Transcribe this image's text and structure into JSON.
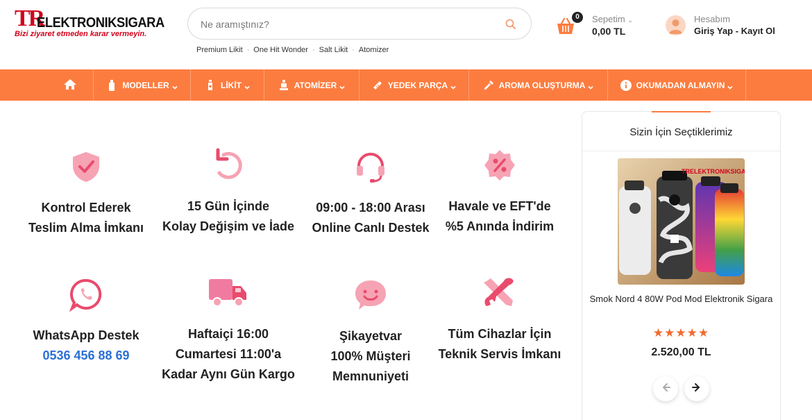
{
  "header": {
    "logo_prefix": "TR",
    "logo_name": "ELEKTRONIKSIGARA",
    "logo_tagline": "Bizi ziyaret etmeden karar vermeyin.",
    "search_placeholder": "Ne aramıştınız?",
    "quick_links": [
      "Premium Likit",
      "One Hit Wonder",
      "Salt Likit",
      "Atomizer"
    ],
    "cart": {
      "label": "Sepetim",
      "count": "0",
      "total": "0,00 TL"
    },
    "account": {
      "label": "Hesabım",
      "login": "Giriş Yap",
      "sep": "-",
      "register": "Kayıt Ol"
    }
  },
  "nav": {
    "items": [
      {
        "label": "",
        "icon": "home-icon"
      },
      {
        "label": "MODELLER",
        "icon": "device-icon"
      },
      {
        "label": "LİKİT",
        "icon": "bottle-icon"
      },
      {
        "label": "ATOMİZER",
        "icon": "atomizer-icon"
      },
      {
        "label": "YEDEK PARÇA",
        "icon": "part-icon"
      },
      {
        "label": "AROMA OLUŞTURMA",
        "icon": "pipette-icon"
      },
      {
        "label": "OKUMADAN ALMAYIN",
        "icon": "info-icon"
      }
    ]
  },
  "features": [
    {
      "icon": "shield-check-icon",
      "lines": [
        "Kontrol Ederek",
        "Teslim Alma İmkanı"
      ]
    },
    {
      "icon": "return-icon",
      "lines": [
        "15 Gün İçinde",
        "Kolay Değişim ve İade"
      ]
    },
    {
      "icon": "headset-icon",
      "lines": [
        "09:00 - 18:00 Arası",
        "Online Canlı Destek"
      ]
    },
    {
      "icon": "discount-icon",
      "lines": [
        "Havale ve EFT'de",
        "%5 Anında İndirim"
      ]
    },
    {
      "icon": "whatsapp-icon",
      "lines": [
        "WhatsApp Destek"
      ],
      "phone": "0536 456 88 69"
    },
    {
      "icon": "truck-icon",
      "lines": [
        "Haftaiçi 16:00",
        "Cumartesi 11:00'a",
        "Kadar Aynı Gün Kargo"
      ]
    },
    {
      "icon": "smile-chat-icon",
      "lines": [
        "Şikayetvar",
        "100% Müşteri",
        "Memnuniyeti"
      ]
    },
    {
      "icon": "tools-icon",
      "lines": [
        "Tüm Cihazlar İçin",
        "Teknik Servis İmkanı"
      ]
    }
  ],
  "sidebar": {
    "title": "Sizin İçin Seçtiklerimiz",
    "product": {
      "name": "Smok Nord 4 80W Pod Mod Elektronik Sigara",
      "image_brand": "TRELEKTRONIKSIGARA",
      "rating": 5,
      "stars": "★★★★★",
      "price": "2.520,00 TL"
    }
  },
  "colors": {
    "accent": "#fc7c3f",
    "icon_pink": "#f0607e",
    "logo_red": "#d0021b",
    "phone_blue": "#2b6fd6"
  }
}
